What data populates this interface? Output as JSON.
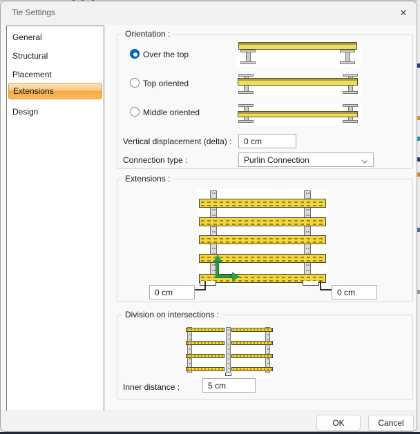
{
  "window": {
    "title": "Tie Settings",
    "close_glyph": "✕"
  },
  "sidebar": {
    "items": [
      {
        "label": "General",
        "selected": false
      },
      {
        "label": "Structural",
        "selected": false
      },
      {
        "label": "Placement",
        "selected": false
      },
      {
        "label": "Extensions",
        "selected": true
      },
      {
        "label": "Design",
        "selected": false
      }
    ]
  },
  "orientation": {
    "legend": "Orientation :",
    "options": [
      {
        "label": "Over the top",
        "selected": true
      },
      {
        "label": "Top oriented",
        "selected": false
      },
      {
        "label": "Middle oriented",
        "selected": false
      }
    ],
    "vertical_displacement_label": "Vertical displacement (delta) :",
    "vertical_displacement_value": "0 cm",
    "connection_type_label": "Connection type :",
    "connection_type_value": "Purlin Connection"
  },
  "extensions": {
    "legend": "Extensions :",
    "left_value": "0 cm",
    "right_value": "0 cm"
  },
  "division": {
    "legend": "Division on intersections :",
    "inner_distance_label": "Inner distance :",
    "inner_distance_value": "5 cm"
  },
  "footer": {
    "ok_label": "OK",
    "cancel_label": "Cancel"
  },
  "colors": {
    "selected_nav_orange": "#f4a93f",
    "radio_blue": "#0067c0",
    "beam_yellow": "#f2d83c",
    "column_gray": "#dcdcdc",
    "arrow_green": "#2f9e41"
  }
}
